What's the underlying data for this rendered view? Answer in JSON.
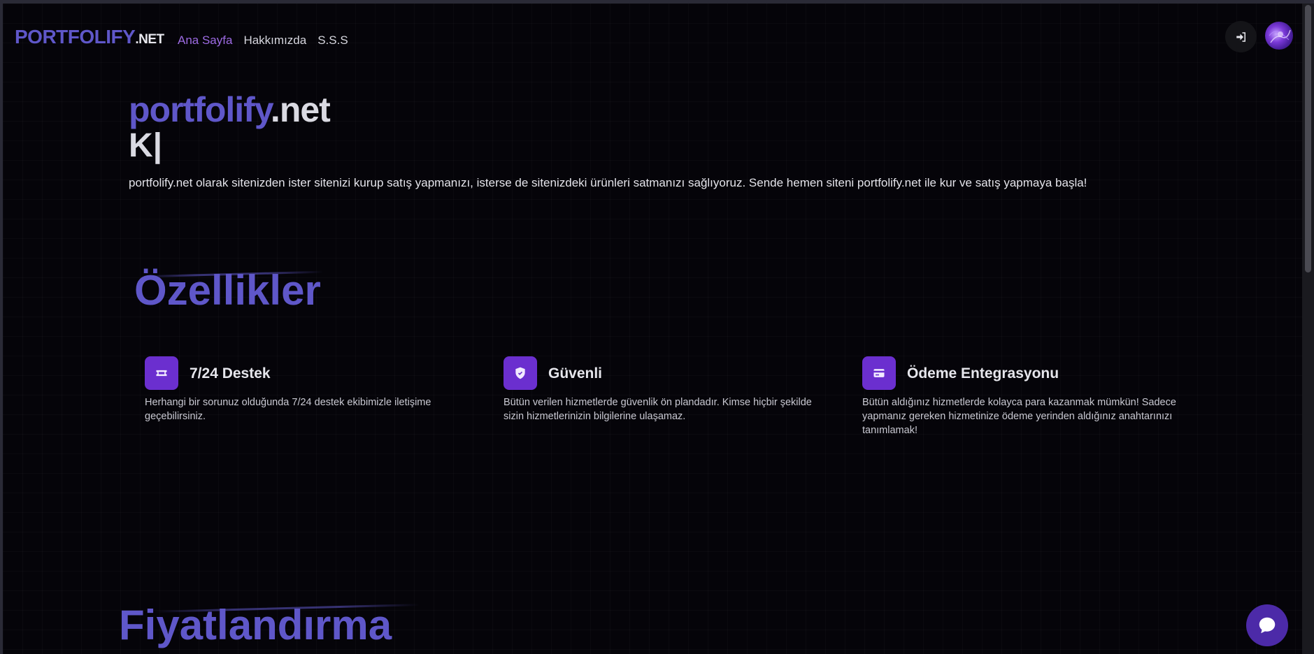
{
  "header": {
    "brand_main": "PORTFOLIFY",
    "brand_tld": ".NET",
    "nav": [
      {
        "label": "Ana Sayfa",
        "active": true
      },
      {
        "label": "Hakkımızda",
        "active": false
      },
      {
        "label": "S.S.S",
        "active": false
      }
    ],
    "login_icon": "sign-in-icon",
    "avatar_icon": "user-avatar"
  },
  "hero": {
    "title_name": "portfolify",
    "title_tld": ".net",
    "typing_text": "K|",
    "description": "portfolify.net olarak sitenizden ister sitenizi kurup satış yapmanızı, isterse de sitenizdeki ürünleri satmanızı sağlıyoruz. Sende hemen siteni portfolify.net ile kur ve satış yapmaya başla!"
  },
  "features_section": {
    "title": "Özellikler",
    "items": [
      {
        "icon": "ticket-icon",
        "title": "7/24 Destek",
        "description": "Herhangi bir sorunuz olduğunda 7/24 destek ekibimizle iletişime geçebilirsiniz."
      },
      {
        "icon": "shield-icon",
        "title": "Güvenli",
        "description": "Bütün verilen hizmetlerde güvenlik ön plandadır. Kimse hiçbir şekilde sizin hizmetlerinizin bilgilerine ulaşamaz."
      },
      {
        "icon": "credit-card-icon",
        "title": "Ödeme Entegrasyonu",
        "description": "Bütün aldığınız hizmetlerde kolayca para kazanmak mümkün! Sadece yapmanız gereken hizmetinize ödeme yerinden aldığınız anahtarınızı tanımlamak!"
      }
    ]
  },
  "pricing_section": {
    "title": "Fiyatlandırma"
  },
  "chat": {
    "icon": "chat-bubble-icon"
  },
  "colors": {
    "accent": "#5f57c9",
    "accent_purple": "#6b2fcf",
    "nav_active": "#9d6be3",
    "background": "#050409"
  }
}
